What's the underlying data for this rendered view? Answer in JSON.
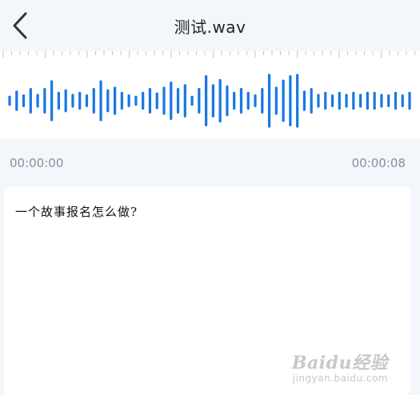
{
  "header": {
    "title": "测试.wav",
    "back_icon": "chevron-left-icon"
  },
  "waveform": {
    "color": "#1677e5",
    "tick_color": "#c4c4c4",
    "levels": [
      0.15,
      0.35,
      0.2,
      0.45,
      0.22,
      0.45,
      0.75,
      0.3,
      0.4,
      0.22,
      0.3,
      0.2,
      0.45,
      0.75,
      0.4,
      0.5,
      0.3,
      0.2,
      0.15,
      0.3,
      0.45,
      0.28,
      0.5,
      0.7,
      0.45,
      0.6,
      0.15,
      0.45,
      0.95,
      0.6,
      0.8,
      0.55,
      0.3,
      0.45,
      0.3,
      0.2,
      0.45,
      1.0,
      0.5,
      0.78,
      0.95,
      1.0,
      0.35,
      0.45,
      0.22,
      0.3,
      0.2,
      0.3,
      0.22,
      0.3,
      0.22,
      0.3,
      0.3,
      0.22,
      0.2,
      0.3,
      0.2,
      0.3
    ]
  },
  "player": {
    "start_time": "00:00:00",
    "end_time": "00:00:08"
  },
  "transcript": {
    "text": "一个故事报名怎么做?"
  },
  "watermark": {
    "brand": "Baidu经验",
    "url": "jingyan.baidu.com"
  }
}
